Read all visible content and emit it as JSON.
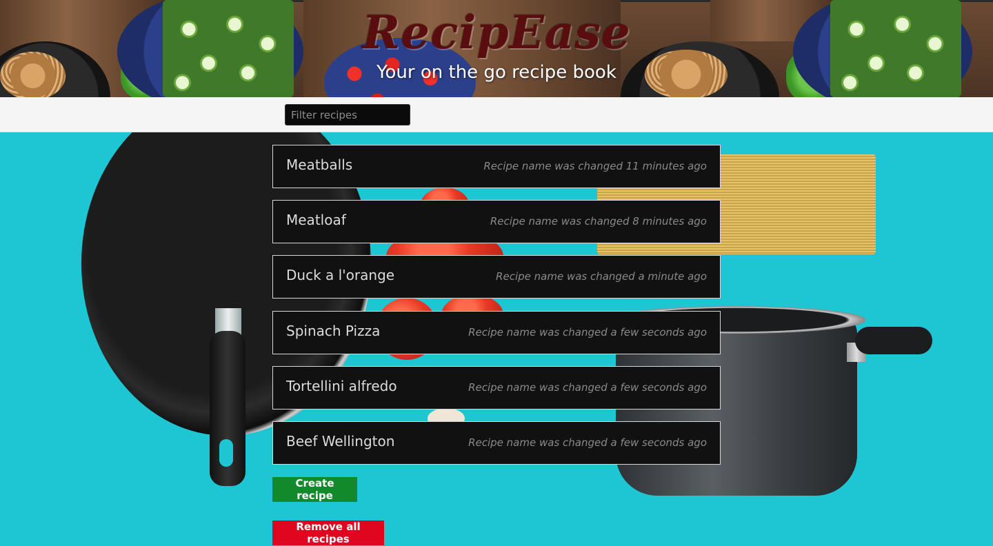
{
  "header": {
    "brand": "RecipEase",
    "tagline": "Your on the go recipe book"
  },
  "filter": {
    "placeholder": "Filter recipes",
    "value": ""
  },
  "recipes": [
    {
      "name": "Meatballs",
      "status": "Recipe name was changed 11 minutes ago"
    },
    {
      "name": "Meatloaf",
      "status": "Recipe name was changed 8 minutes ago"
    },
    {
      "name": "Duck a l'orange",
      "status": "Recipe name was changed a minute ago"
    },
    {
      "name": "Spinach Pizza",
      "status": "Recipe name was changed a few seconds ago"
    },
    {
      "name": "Tortellini alfredo",
      "status": "Recipe name was changed a few seconds ago"
    },
    {
      "name": "Beef Wellington",
      "status": "Recipe name was changed a few seconds ago"
    }
  ],
  "actions": {
    "create_label": "Create recipe",
    "remove_all_label": "Remove all recipes"
  },
  "colors": {
    "brand": "#5a0d0f",
    "background": "#1ec6d4",
    "card": "#111111",
    "create": "#128a2c",
    "remove": "#e0061f"
  }
}
